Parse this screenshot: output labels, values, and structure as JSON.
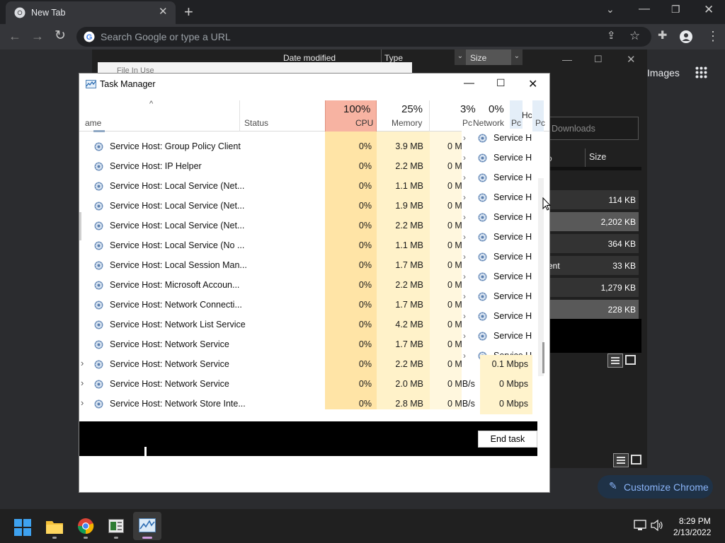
{
  "chrome": {
    "tab_title": "New Tab",
    "omnibox_placeholder": "Search Google or type a URL",
    "images_link": "Images",
    "customize_label": "Customize Chrome"
  },
  "explorer": {
    "col_date_modified": "Date modified",
    "col_type": "Type",
    "col_size": "Size",
    "file_in_use_title": "File In Use",
    "search_placeholder": "Downloads",
    "col_po": "Po",
    "col_size2": "Size",
    "rows": [
      {
        "name": "",
        "size": "114 KB"
      },
      {
        "name": "",
        "size": "2,202 KB"
      },
      {
        "name": "",
        "size": "364 KB"
      },
      {
        "name": "ent",
        "size": "33 KB"
      },
      {
        "name": "",
        "size": "1,279 KB"
      },
      {
        "name": "",
        "size": "228 KB"
      }
    ]
  },
  "task_manager": {
    "title": "Task Manager",
    "headers": {
      "name": "ame",
      "status": "Status",
      "cpu_pct": "100%",
      "cpu": "CPU",
      "mem_pct": "25%",
      "mem": "Memory",
      "disk_pct": "3%",
      "disk": "Pc",
      "net_pct": "0%",
      "net": "Network",
      "po1": "Pc",
      "ho": "Hc",
      "po2": "Pc"
    },
    "rows": [
      {
        "name": "Service Host: Group Policy Client",
        "cpu": "0%",
        "mem": "3.9 MB",
        "disk": "0 M",
        "expand": false
      },
      {
        "name": "Service Host: IP Helper",
        "cpu": "0%",
        "mem": "2.2 MB",
        "disk": "0 M",
        "expand": false
      },
      {
        "name": "Service Host: Local Service (Net...",
        "cpu": "0%",
        "mem": "1.1 MB",
        "disk": "0 M",
        "expand": false
      },
      {
        "name": "Service Host: Local Service (Net...",
        "cpu": "0%",
        "mem": "1.9 MB",
        "disk": "0 M",
        "expand": false
      },
      {
        "name": "Service Host: Local Service (Net...",
        "cpu": "0%",
        "mem": "2.2 MB",
        "disk": "0 M",
        "expand": false
      },
      {
        "name": "Service Host: Local Service (No ...",
        "cpu": "0%",
        "mem": "1.1 MB",
        "disk": "0 M",
        "expand": false
      },
      {
        "name": "Service Host: Local Session Man...",
        "cpu": "0%",
        "mem": "1.7 MB",
        "disk": "0 M",
        "expand": false
      },
      {
        "name": "Service Host: Microsoft Accoun...",
        "cpu": "0%",
        "mem": "2.2 MB",
        "disk": "0 M",
        "expand": false
      },
      {
        "name": "Service Host: Network Connecti...",
        "cpu": "0%",
        "mem": "1.7 MB",
        "disk": "0 M",
        "expand": false
      },
      {
        "name": "Service Host: Network List Service",
        "cpu": "0%",
        "mem": "4.2 MB",
        "disk": "0 M",
        "expand": false
      },
      {
        "name": "Service Host: Network Service",
        "cpu": "0%",
        "mem": "1.7 MB",
        "disk": "0 M",
        "expand": false
      },
      {
        "name": "Service Host: Network Service",
        "cpu": "0%",
        "mem": "2.2 MB",
        "disk": "0 M",
        "expand": true
      },
      {
        "name": "Service Host: Network Service",
        "cpu": "0%",
        "mem": "2.0 MB",
        "disk": "0 MB/s",
        "expand": true
      },
      {
        "name": "Service Host: Network Store Inte...",
        "cpu": "0%",
        "mem": "2.8 MB",
        "disk": "0 MB/s",
        "expand": true
      }
    ],
    "overlay_item": "Service Hc",
    "net_values": [
      "0.1 Mbps",
      "0 Mbps",
      "0 Mbps"
    ],
    "end_task": "End task"
  },
  "taskbar": {
    "time": "8:29 PM",
    "date": "2/13/2022"
  }
}
